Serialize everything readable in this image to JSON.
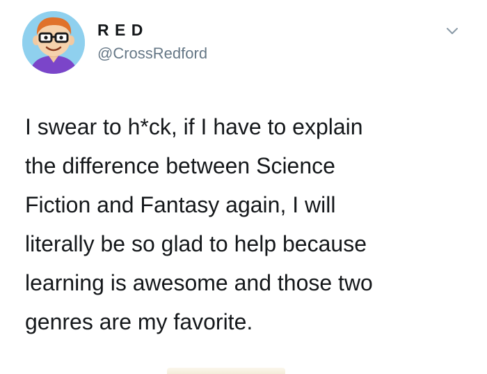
{
  "author": {
    "display_name": "R E D",
    "handle": "@CrossRedford",
    "avatar_icon": "cartoon-avatar-icon"
  },
  "menu": {
    "icon": "chevron-down-icon"
  },
  "tweet": {
    "lines": [
      "I swear to h*ck, if I have to explain",
      "the difference between Science",
      "Fiction and Fantasy again, I will",
      "literally be so glad to help because",
      "learning is awesome and those two",
      "genres are my favorite."
    ]
  },
  "colors": {
    "text": "#14171a",
    "secondary": "#657786",
    "avatar_bg": "#8fd0ee",
    "shirt": "#7b45c9"
  }
}
